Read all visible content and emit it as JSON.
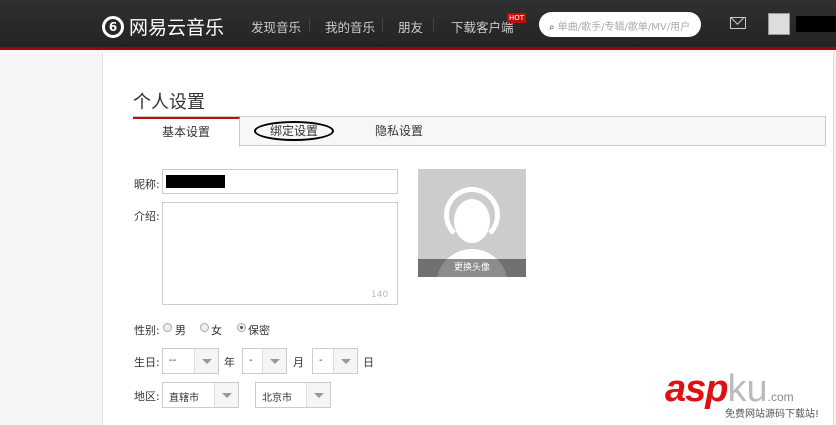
{
  "header": {
    "logo": "网易云音乐",
    "nav": [
      "发现音乐",
      "我的音乐",
      "朋友",
      "下载客户端"
    ],
    "hot_badge": "HOT",
    "search_placeholder": "单曲/歌手/专辑/歌单/MV/用户"
  },
  "page": {
    "title": "个人设置",
    "tabs": [
      "基本设置",
      "绑定设置",
      "隐私设置"
    ]
  },
  "form": {
    "nickname_label": "昵称:",
    "intro_label": "介绍:",
    "intro_counter": "140",
    "avatar_change": "更换头像",
    "gender_label": "性别:",
    "gender_options": [
      "男",
      "女",
      "保密"
    ],
    "gender_selected": "保密",
    "birthday_label": "生日:",
    "year_value": "--",
    "year_unit": "年",
    "month_value": "-",
    "month_unit": "月",
    "day_value": "-",
    "day_unit": "日",
    "region_label": "地区:",
    "province": "直辖市",
    "city": "北京市"
  },
  "watermark": {
    "brand1": "asp",
    "brand2": "ku",
    "suffix": ".com",
    "tagline": "免费网站源码下载站!"
  }
}
